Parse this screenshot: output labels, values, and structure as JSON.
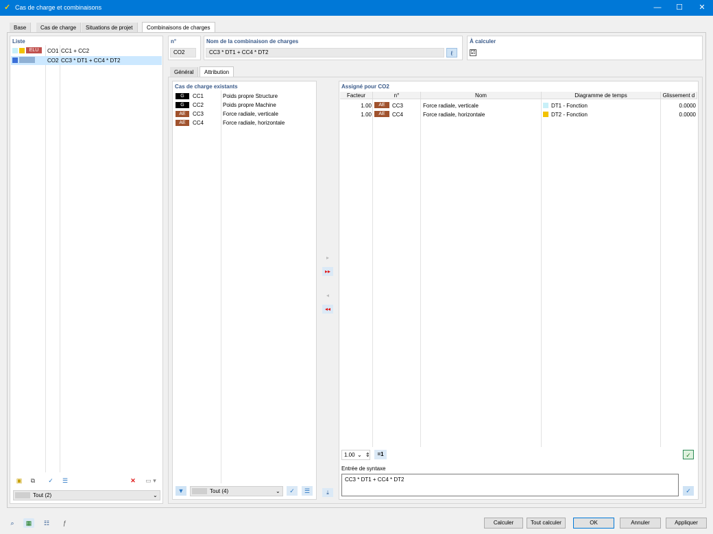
{
  "window": {
    "title": "Cas de charge et combinaisons"
  },
  "tabs": [
    {
      "label": "Base"
    },
    {
      "label": "Cas de charge"
    },
    {
      "label": "Situations de projet"
    },
    {
      "label": "Combinaisons de charges"
    }
  ],
  "list": {
    "header": "Liste",
    "items": [
      {
        "badge": "ELU",
        "no": "CO1",
        "desc": "CC1 + CC2",
        "colors": [
          "#c8f0f8",
          "#f2c200"
        ]
      },
      {
        "badge": "",
        "no": "CO2",
        "desc": "CC3 * DT1 + CC4 * DT2",
        "colors": [
          "#3a6fd8"
        ]
      }
    ],
    "filter": "Tout (2)"
  },
  "combo": {
    "no_label": "n°",
    "no_value": "CO2",
    "name_label": "Nom de la combinaison de charges",
    "name_value": "CC3 * DT1 + CC4 * DT2",
    "calc_label": "À calculer",
    "calc_checked": "☑"
  },
  "subtabs": [
    {
      "label": "Général"
    },
    {
      "label": "Attribution"
    }
  ],
  "existing": {
    "header": "Cas de charge existants",
    "rows": [
      {
        "tag": "G",
        "no": "CC1",
        "name": "Poids propre Structure",
        "tag_color": "#000000"
      },
      {
        "tag": "G",
        "no": "CC2",
        "name": "Poids propre Machine",
        "tag_color": "#000000"
      },
      {
        "tag": "AE",
        "no": "CC3",
        "name": "Force radiale, verticale",
        "tag_color": "#a0522d"
      },
      {
        "tag": "AE",
        "no": "CC4",
        "name": "Force radiale, horizontale",
        "tag_color": "#a0522d"
      }
    ],
    "filter": "Tout (4)"
  },
  "assigned": {
    "header": "Assigné pour CO2",
    "columns": [
      "Facteur",
      "n°",
      "Nom",
      "Diagramme de temps",
      "Glissement d"
    ],
    "rows": [
      {
        "factor": "1.00",
        "tag": "AE",
        "no": "CC3",
        "name": "Force radiale, verticale",
        "diagram": "DT1 - Fonction",
        "diag_color": "#c8f0f8",
        "slide": "0.0000"
      },
      {
        "factor": "1.00",
        "tag": "AE",
        "no": "CC4",
        "name": "Force radiale, horizontale",
        "diagram": "DT2 - Fonction",
        "diag_color": "#f2c200",
        "slide": "0.0000"
      }
    ],
    "factor_value": "1.00",
    "factor_btn": "=1",
    "syntax_label": "Entrée de syntaxe",
    "syntax_value": "CC3 * DT1 + CC4 * DT2"
  },
  "buttons": {
    "calculer": "Calculer",
    "tout_calculer": "Tout calculer",
    "ok": "OK",
    "annuler": "Annuler",
    "appliquer": "Appliquer"
  },
  "colors": {
    "accent": "#0078d7",
    "label_blue": "#3b5b8a",
    "selection": "#cce8ff"
  }
}
